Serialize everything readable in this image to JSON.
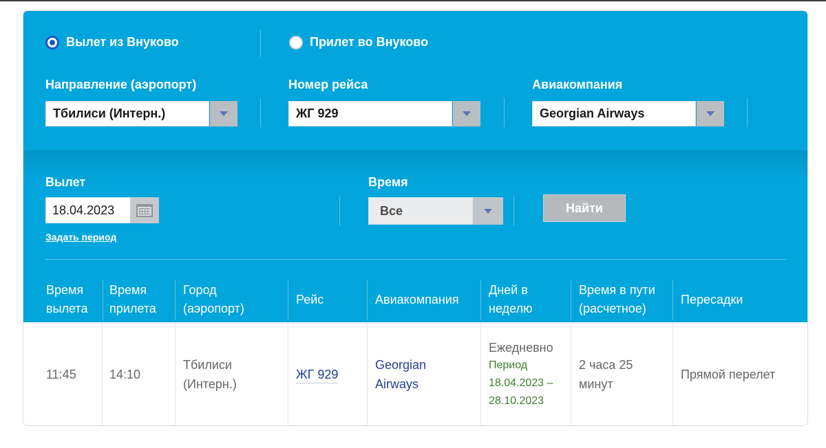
{
  "direction_toggle": {
    "departure_label": "Вылет из Внуково",
    "arrival_label": "Прилет во Внуково",
    "selected": "departure"
  },
  "filters": {
    "destination_label": "Направление (аэропорт)",
    "destination_value": "Тбилиси (Интерн.)",
    "flight_number_label": "Номер рейса",
    "flight_number_value": "ЖГ 929",
    "airline_label": "Авиакомпания",
    "airline_value": "Georgian Airways",
    "departure_label": "Вылет",
    "departure_date": "18.04.2023",
    "set_period_link": "Задать период",
    "time_label": "Время",
    "time_value": "Все",
    "find_button": "Найти"
  },
  "table": {
    "headers": [
      [
        "Время",
        "вылета"
      ],
      [
        "Время",
        "прилета"
      ],
      [
        "Город",
        "(аэропорт)"
      ],
      [
        "Рейс"
      ],
      [
        "Авиакомпания"
      ],
      [
        "Дней в",
        "неделю"
      ],
      [
        "Время в пути",
        "(расчетное)"
      ],
      [
        "Пересадки"
      ]
    ],
    "rows": [
      {
        "departure_time": "11:45",
        "arrival_time": "14:10",
        "city": [
          "Тбилиси",
          "(Интерн.)"
        ],
        "flight": "ЖГ 929",
        "airline": [
          "Georgian",
          "Airways"
        ],
        "days": "Ежедневно",
        "period_label": "Период",
        "period_range": [
          "18.04.2023 –",
          "28.10.2023"
        ],
        "duration": [
          "2 часа 25",
          "минут"
        ],
        "transfers": "Прямой перелет"
      }
    ]
  },
  "colors": {
    "panel_blue": "#02a5dc",
    "radio_selected": "#1f57c8",
    "link_blue": "#1e3d8f",
    "period_green": "#3a7d2c"
  }
}
